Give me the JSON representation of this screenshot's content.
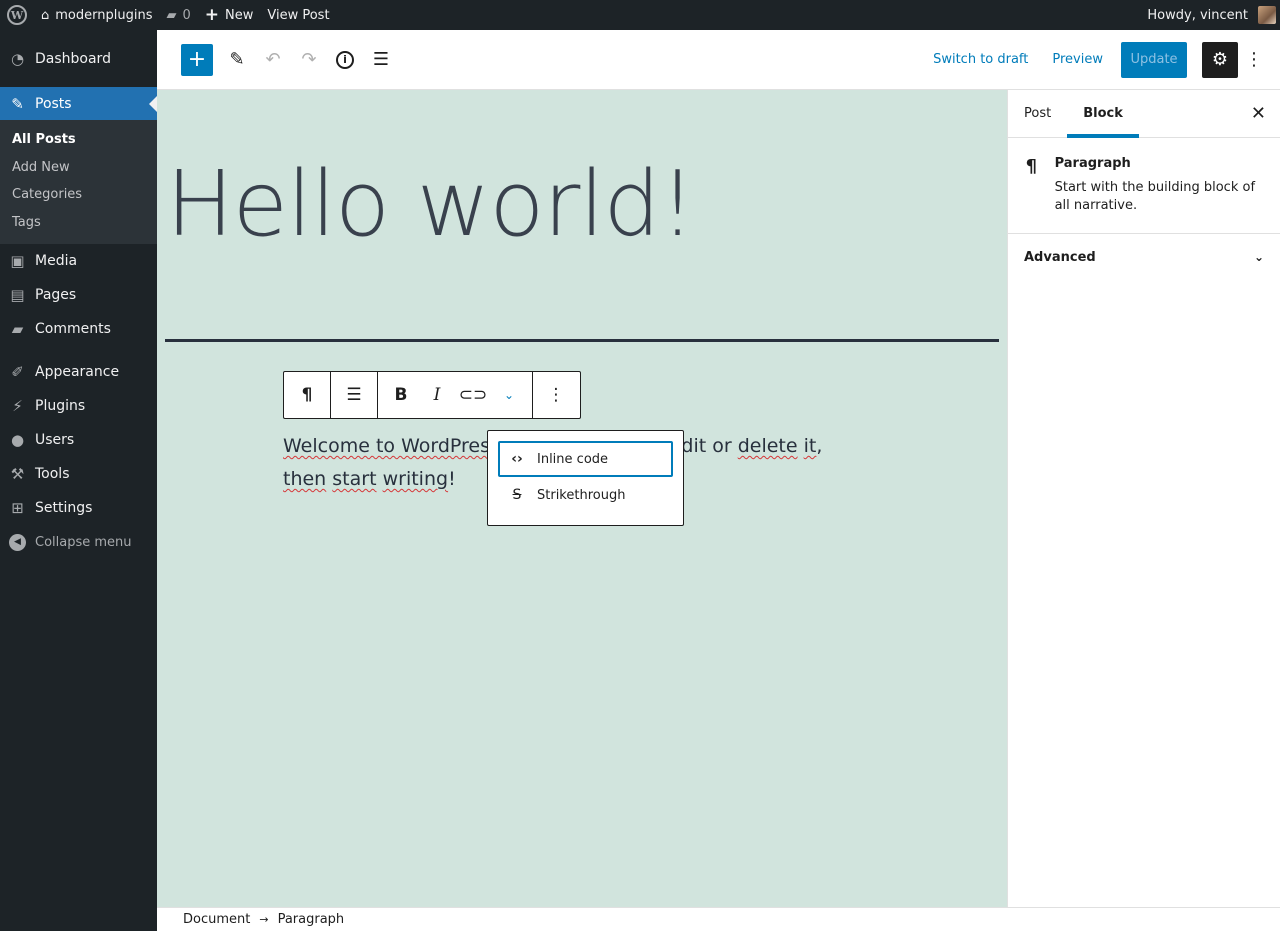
{
  "admin_bar": {
    "site_name": "modernplugins",
    "comments_count": "0",
    "new_label": "New",
    "view_post_label": "View Post",
    "greeting": "Howdy, vincent"
  },
  "menu": {
    "dashboard": "Dashboard",
    "posts": "Posts",
    "posts_sub": [
      "All Posts",
      "Add New",
      "Categories",
      "Tags"
    ],
    "media": "Media",
    "pages": "Pages",
    "comments": "Comments",
    "appearance": "Appearance",
    "plugins": "Plugins",
    "users": "Users",
    "tools": "Tools",
    "settings": "Settings",
    "collapse": "Collapse menu"
  },
  "header": {
    "switch_to_draft": "Switch to draft",
    "preview": "Preview",
    "update": "Update"
  },
  "post": {
    "title": "Hello world!",
    "paragraph_start": "Welcome to WordPress",
    "paragraph_mid": ". Edit or ",
    "paragraph_delete": "delete",
    "paragraph_it": "it",
    "paragraph_comma": ",",
    "paragraph_then": "then",
    "paragraph_start_word": "start",
    "paragraph_writing": "writing",
    "paragraph_end": "!"
  },
  "format_dropdown": {
    "items": [
      "Inline code",
      "Strikethrough"
    ]
  },
  "settings_panel": {
    "tabs": [
      "Post",
      "Block"
    ],
    "active_tab": "Block",
    "block_title": "Paragraph",
    "block_description": "Start with the building block of all narrative.",
    "advanced": "Advanced"
  },
  "breadcrumb": {
    "items": [
      "Document",
      "Paragraph"
    ]
  },
  "colors": {
    "accent": "#007cba",
    "admin_bg": "#1d2327",
    "canvas_bg": "#d1e4dd"
  }
}
